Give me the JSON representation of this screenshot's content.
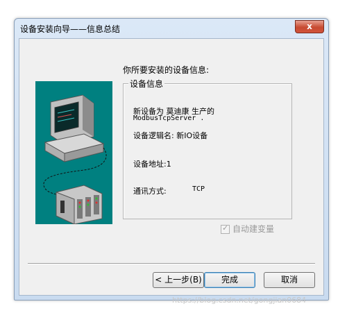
{
  "window": {
    "title": "设备安装向导——信息总结",
    "close_label": "x"
  },
  "heading": "你所要安装的设备信息:",
  "group": {
    "legend": "设备信息",
    "line1": "新设备为 莫迪康 生产的",
    "line1b": "ModbusTcpServer .",
    "line2": "设备逻辑名: 新IO设备",
    "line3": "设备地址:1",
    "line4_label": "通讯方式:",
    "line4_value": "TCP"
  },
  "checkbox": {
    "label": "自动建变量",
    "checked": true,
    "disabled": true
  },
  "buttons": {
    "back": "< 上一步(B)",
    "finish": "完成",
    "cancel": "取消"
  },
  "watermark": "https://blog.csdn.net/gongjian0684",
  "colors": {
    "illustration_bg": "#008080",
    "dialog_bg": "#f0f0f0"
  }
}
